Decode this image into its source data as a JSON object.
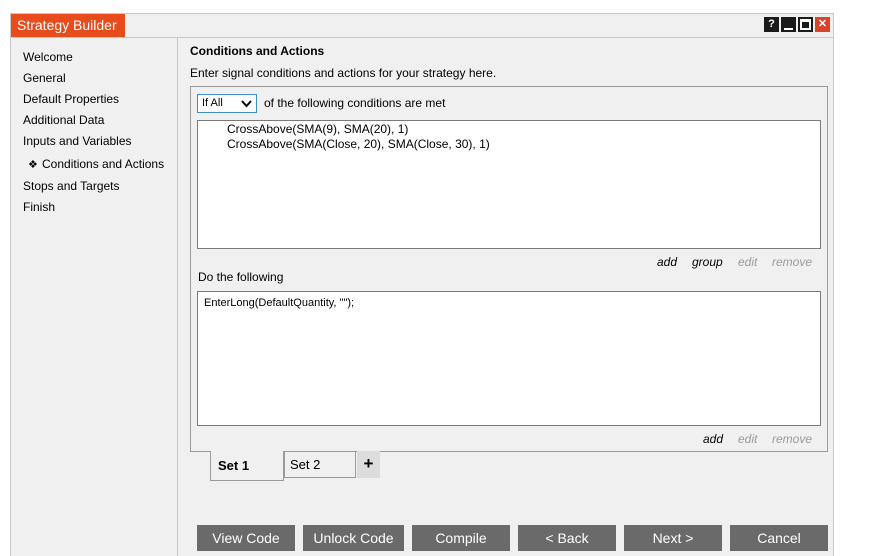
{
  "window": {
    "title": "Strategy Builder",
    "controls": {
      "help": "?",
      "minimize": "minimize",
      "maximize": "maximize",
      "close": "✕"
    }
  },
  "sidebar": {
    "items": [
      {
        "label": "Welcome",
        "active": false
      },
      {
        "label": "General",
        "active": false
      },
      {
        "label": "Default Properties",
        "active": false
      },
      {
        "label": "Additional Data",
        "active": false
      },
      {
        "label": "Inputs and Variables",
        "active": false
      },
      {
        "label": "Conditions and Actions",
        "active": true,
        "bullet": "❖"
      },
      {
        "label": "Stops and Targets",
        "active": false
      },
      {
        "label": "Finish",
        "active": false
      }
    ]
  },
  "main": {
    "heading": "Conditions and Actions",
    "subheading": "Enter signal conditions and actions for your strategy here.",
    "condition_mode": {
      "selected": "If All",
      "suffix": "of the following conditions are met"
    },
    "conditions": [
      "CrossAbove(SMA(9), SMA(20), 1)",
      "CrossAbove(SMA(Close, 20), SMA(Close, 30), 1)"
    ],
    "condition_actions": {
      "add": "add",
      "group": "group",
      "edit": "edit",
      "remove": "remove"
    },
    "do_label": "Do the following",
    "actions": [
      "EnterLong(DefaultQuantity, \"\");"
    ],
    "action_actions": {
      "add": "add",
      "edit": "edit",
      "remove": "remove"
    },
    "sets": [
      {
        "label": "Set 1",
        "active": true
      },
      {
        "label": "Set 2",
        "active": false
      }
    ],
    "add_set": "+"
  },
  "footer": {
    "view_code": "View Code",
    "unlock_code": "Unlock Code",
    "compile": "Compile",
    "back": "< Back",
    "next": "Next >",
    "cancel": "Cancel"
  },
  "colors": {
    "title_accent": "#e84c1d",
    "button_bg": "#6a6a6a",
    "select_border": "#3a8fd0",
    "disabled_link": "#9a9a9a"
  }
}
